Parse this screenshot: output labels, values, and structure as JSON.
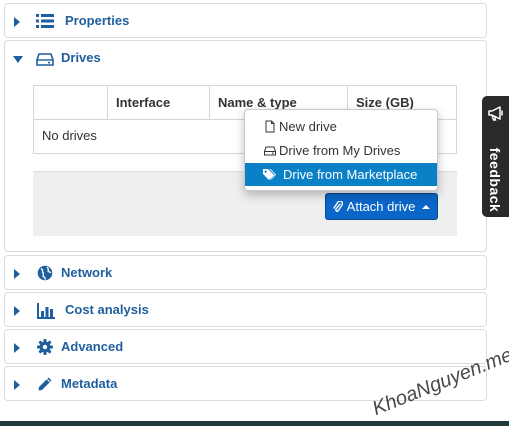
{
  "sections": {
    "properties": "Properties",
    "drives": "Drives",
    "network": "Network",
    "cost_analysis": "Cost analysis",
    "advanced": "Advanced",
    "metadata": "Metadata"
  },
  "drives_table": {
    "columns": [
      "",
      "Interface",
      "Name & type",
      "Size (GB)"
    ],
    "empty_text": "No drives"
  },
  "attach_button": {
    "label": "Attach drive"
  },
  "attach_menu": {
    "items": [
      {
        "label": "New drive",
        "icon": "file-icon",
        "active": false
      },
      {
        "label": "Drive from My Drives",
        "icon": "hdd-icon",
        "active": false
      },
      {
        "label": "Drive from Marketplace",
        "icon": "tags-icon",
        "active": true
      }
    ]
  },
  "feedback": {
    "label": "feedback",
    "icon": "megaphone-icon"
  },
  "watermark": "KhoaNguyen.me",
  "colors": {
    "accent": "#1f5f9e",
    "button": "#0a66c8",
    "menu_active": "#0a81c7",
    "feedback_bg": "#2a2a2a"
  }
}
